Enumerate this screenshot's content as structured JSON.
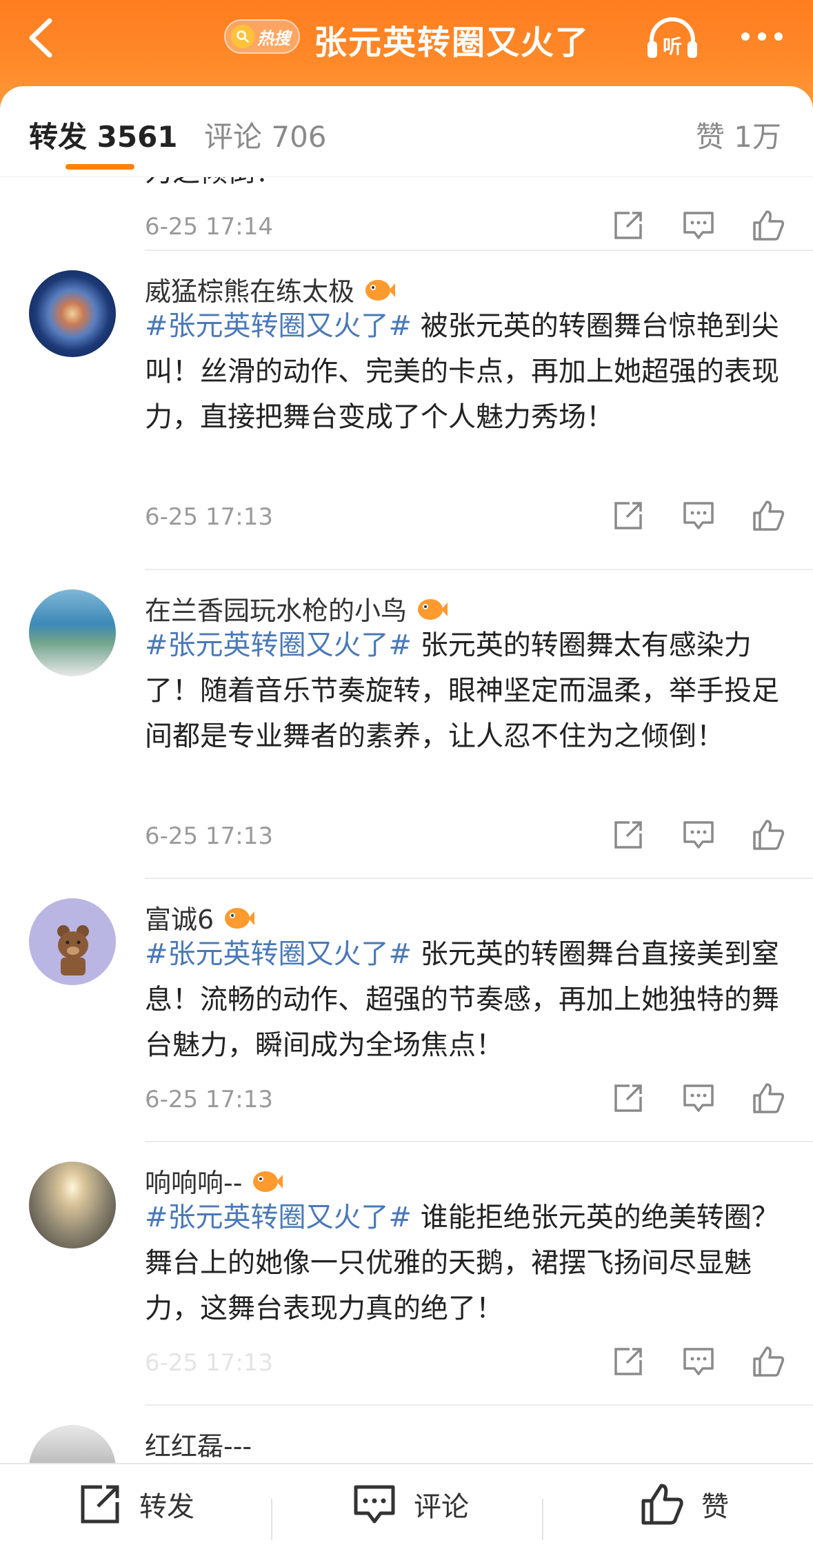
{
  "header": {
    "badge_text": "热搜",
    "title": "张元英转圈又火了",
    "listen_label": "听",
    "colors": {
      "gradient_start": "#ff7d1f",
      "gradient_end": "#ff9a3c"
    }
  },
  "tabs": {
    "repost": "转发 3561",
    "comment": "评论 706",
    "like": "赞 1万",
    "indicator_color": "#ff8200"
  },
  "feed": {
    "partial": {
      "text": "为之倾倒！",
      "time": "6-25 17:14"
    },
    "items": [
      {
        "username": "威猛棕熊在练太极",
        "hashtag": "#张元英转圈又火了#",
        "text": " 被张元英的转圈舞台惊艳到尖叫！丝滑的动作、完美的卡点，再加上她超强的表现力，直接把舞台变成了个人魅力秀场！",
        "time": "6-25 17:13"
      },
      {
        "username": "在兰香园玩水枪的小鸟",
        "hashtag": "#张元英转圈又火了#",
        "text": " 张元英的转圈舞太有感染力了！随着音乐节奏旋转，眼神坚定而温柔，举手投足间都是专业舞者的素养，让人忍不住为之倾倒！",
        "time": "6-25 17:13"
      },
      {
        "username": "富诚6",
        "hashtag": "#张元英转圈又火了#",
        "text": " 张元英的转圈舞台直接美到窒息！流畅的动作、超强的节奏感，再加上她独特的舞台魅力，瞬间成为全场焦点！",
        "time": "6-25 17:13"
      },
      {
        "username": "响响响--",
        "hashtag": "#张元英转圈又火了#",
        "text": " 谁能拒绝张元英的绝美转圈？舞台上的她像一只优雅的天鹅，裙摆飞扬间尽显魅力，这舞台表现力真的绝了！",
        "time": "6-25 17:13"
      },
      {
        "username": "红红磊---"
      }
    ]
  },
  "bottom_bar": {
    "repost": "转发",
    "comment": "评论",
    "like": "赞"
  }
}
